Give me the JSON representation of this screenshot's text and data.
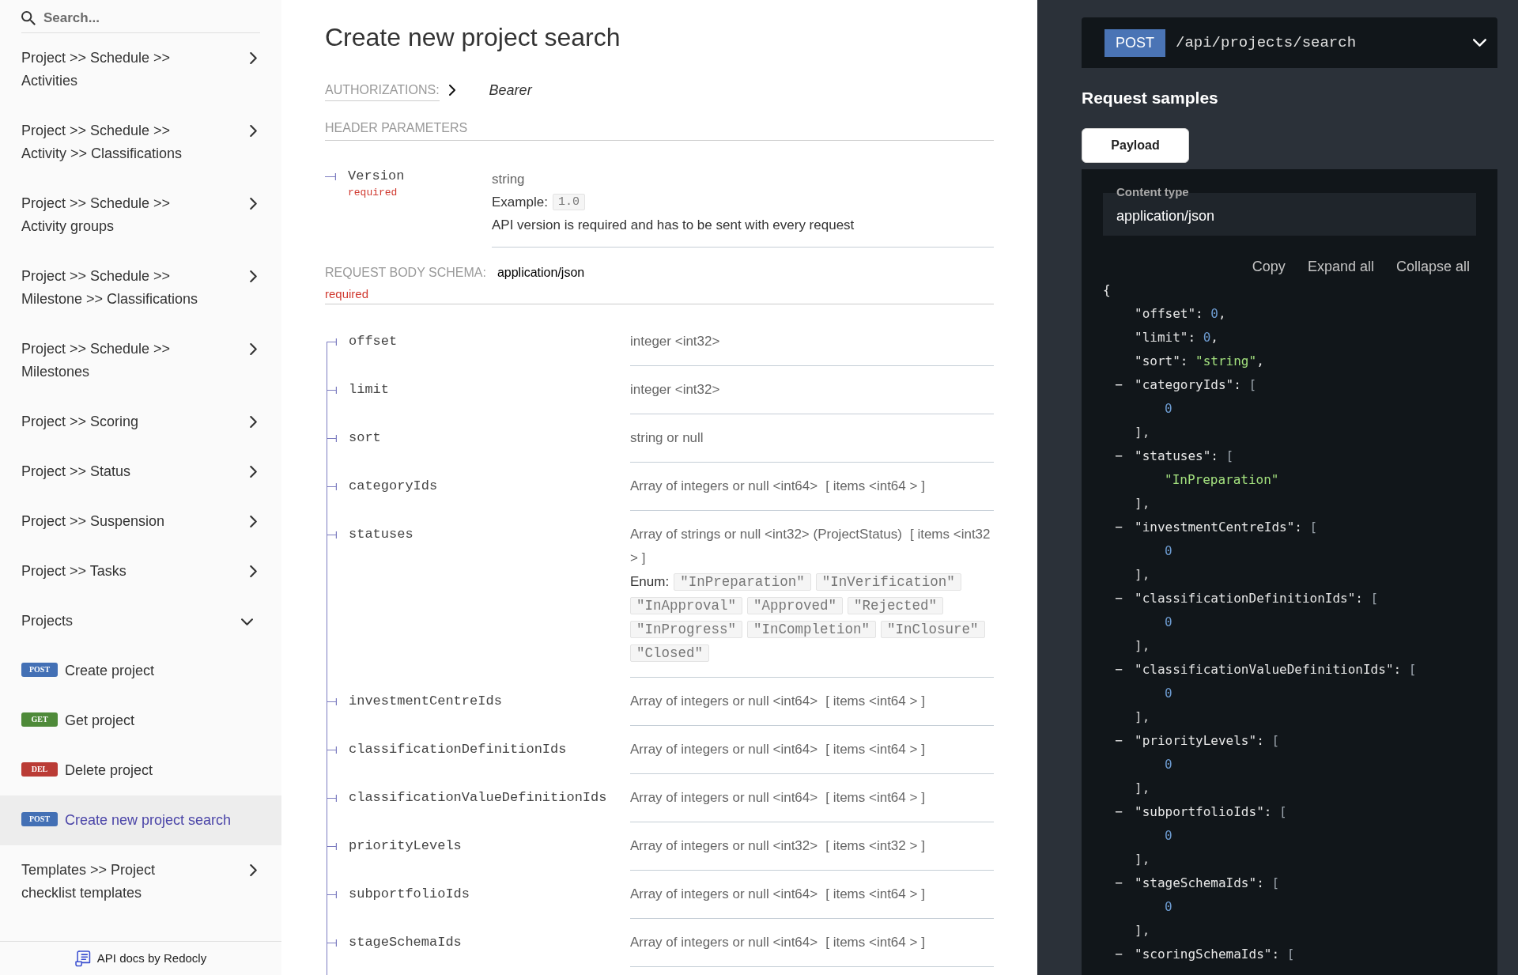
{
  "sidebar": {
    "search": {
      "placeholder": "Search..."
    },
    "items": [
      {
        "label": "Project >> Schedule >> Activities",
        "expanded": false
      },
      {
        "label": "Project >> Schedule >> Activity >> Classifications",
        "expanded": false
      },
      {
        "label": "Project >> Schedule >> Activity groups",
        "expanded": false
      },
      {
        "label": "Project >> Schedule >> Milestone >> Classifications",
        "expanded": false
      },
      {
        "label": "Project >> Schedule >> Milestones",
        "expanded": false
      },
      {
        "label": "Project >> Scoring",
        "expanded": false
      },
      {
        "label": "Project >> Status",
        "expanded": false
      },
      {
        "label": "Project >> Suspension",
        "expanded": false
      },
      {
        "label": "Project >> Tasks",
        "expanded": false
      },
      {
        "label": "Projects",
        "expanded": true,
        "children": [
          {
            "method": "POST",
            "color": "#4370b5",
            "label": "Create project",
            "selected": false
          },
          {
            "method": "GET",
            "color": "#4e8a39",
            "label": "Get project",
            "selected": false
          },
          {
            "method": "DEL",
            "color": "#ba3b35",
            "label": "Delete project",
            "selected": false
          },
          {
            "method": "POST",
            "color": "#4370b5",
            "label": "Create new project search",
            "selected": true
          }
        ]
      },
      {
        "label": "Templates >> Project checklist templates",
        "expanded": false
      }
    ],
    "footer": "API docs by Redocly"
  },
  "operation": {
    "title": "Create new project search",
    "authorizations": {
      "label": "AUTHORIZATIONS:",
      "expanded": false,
      "value": "Bearer"
    },
    "header_parameters": {
      "title": "HEADER PARAMETERS",
      "params": [
        {
          "name": "Version",
          "required": "required",
          "type": "string",
          "example_label": "Example:",
          "example": "1.0",
          "description": "API version is required and has to be sent with every request"
        }
      ]
    },
    "request_body": {
      "title": "REQUEST BODY SCHEMA:",
      "content_type": "application/json",
      "required": "required",
      "fields": [
        {
          "name": "offset",
          "type": "integer <int32>"
        },
        {
          "name": "limit",
          "type": "integer <int32>"
        },
        {
          "name": "sort",
          "type": "string or null"
        },
        {
          "name": "categoryIds",
          "type": "Array of integers or null <int64>",
          "items": "[ items <int64 > ]"
        },
        {
          "name": "statuses",
          "type": "Array of strings or null <int32> (ProjectStatus)",
          "items": "[ items <int32 > ]",
          "enum_label": "Enum:",
          "enum": [
            "\"InPreparation\"",
            "\"InVerification\"",
            "\"InApproval\"",
            "\"Approved\"",
            "\"Rejected\"",
            "\"InProgress\"",
            "\"InCompletion\"",
            "\"InClosure\"",
            "\"Closed\""
          ]
        },
        {
          "name": "investmentCentreIds",
          "type": "Array of integers or null <int64>",
          "items": "[ items <int64 > ]"
        },
        {
          "name": "classificationDefinitionIds",
          "type": "Array of integers or null <int64>",
          "items": "[ items <int64 > ]"
        },
        {
          "name": "classificationValueDefinitionIds",
          "type": "Array of integers or null <int64>",
          "items": "[ items <int64 > ]"
        },
        {
          "name": "priorityLevels",
          "type": "Array of integers or null <int32>",
          "items": "[ items <int32 > ]"
        },
        {
          "name": "subportfolioIds",
          "type": "Array of integers or null <int64>",
          "items": "[ items <int64 > ]"
        },
        {
          "name": "stageSchemaIds",
          "type": "Array of integers or null <int64>",
          "items": "[ items <int64 > ]"
        }
      ]
    }
  },
  "right_panel": {
    "endpoint": {
      "method": "POST",
      "path": "/api/projects/search"
    },
    "request_samples": {
      "title": "Request samples",
      "tabs": [
        {
          "label": "Payload",
          "selected": true
        }
      ],
      "content_type": {
        "label": "Content type",
        "value": "application/json"
      },
      "actions": [
        "Copy",
        "Expand all",
        "Collapse all"
      ],
      "sample": {
        "open": "{",
        "children": [
          {
            "kind": "number",
            "key": "\"offset\":",
            "value": "0",
            "punct": ","
          },
          {
            "kind": "number",
            "key": "\"limit\":",
            "value": "0",
            "punct": ","
          },
          {
            "kind": "string",
            "key": "\"sort\":",
            "value": "\"string\"",
            "punct": ","
          },
          {
            "kind": "array",
            "toggle": "−",
            "key": "\"categoryIds\":",
            "open": "[",
            "children": [
              {
                "kind": "number",
                "value": "0"
              }
            ],
            "close": "],"
          },
          {
            "kind": "array",
            "toggle": "−",
            "key": "\"statuses\":",
            "open": "[",
            "children": [
              {
                "kind": "string",
                "value": "\"InPreparation\""
              }
            ],
            "close": "],"
          },
          {
            "kind": "array",
            "toggle": "−",
            "key": "\"investmentCentreIds\":",
            "open": "[",
            "children": [
              {
                "kind": "number",
                "value": "0"
              }
            ],
            "close": "],"
          },
          {
            "kind": "array",
            "toggle": "−",
            "key": "\"classificationDefinitionIds\":",
            "open": "[",
            "children": [
              {
                "kind": "number",
                "value": "0"
              }
            ],
            "close": "],"
          },
          {
            "kind": "array",
            "toggle": "−",
            "key": "\"classificationValueDefinitionIds\":",
            "open": "[",
            "children": [
              {
                "kind": "number",
                "value": "0"
              }
            ],
            "close": "],"
          },
          {
            "kind": "array",
            "toggle": "−",
            "key": "\"priorityLevels\":",
            "open": "[",
            "children": [
              {
                "kind": "number",
                "value": "0"
              }
            ],
            "close": "],"
          },
          {
            "kind": "array",
            "toggle": "−",
            "key": "\"subportfolioIds\":",
            "open": "[",
            "children": [
              {
                "kind": "number",
                "value": "0"
              }
            ],
            "close": "],"
          },
          {
            "kind": "array",
            "toggle": "−",
            "key": "\"stageSchemaIds\":",
            "open": "[",
            "children": [
              {
                "kind": "number",
                "value": "0"
              }
            ],
            "close": "],"
          },
          {
            "kind": "array",
            "toggle": "−",
            "key": "\"scoringSchemaIds\":",
            "open": "["
          }
        ]
      }
    }
  }
}
